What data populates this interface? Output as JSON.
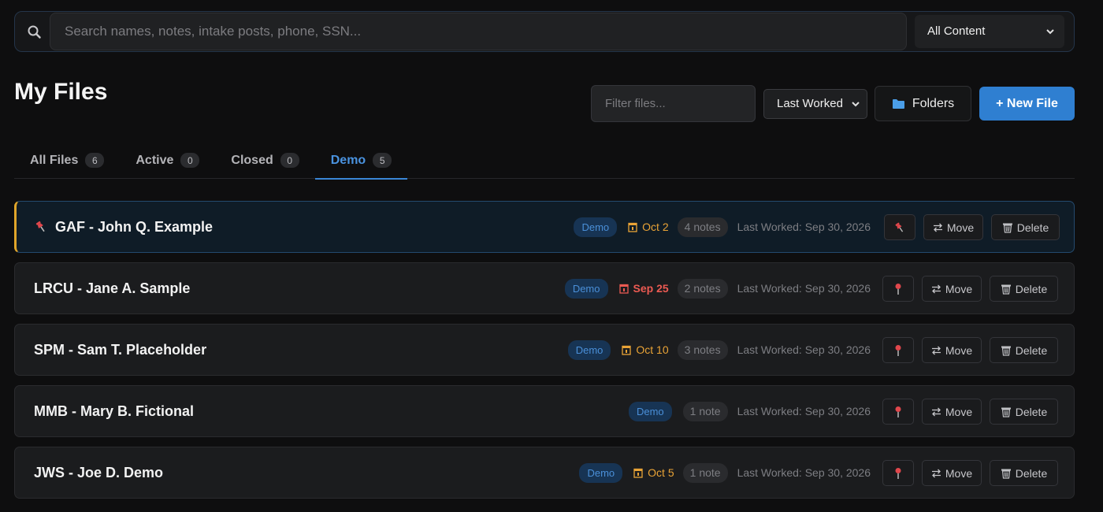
{
  "search": {
    "placeholder": "Search names, notes, intake posts, phone, SSN...",
    "icon": "search-icon",
    "scope": {
      "selected": "All Content"
    }
  },
  "header": {
    "title": "My Files",
    "filter_placeholder": "Filter files...",
    "sort": {
      "selected": "Last Worked"
    },
    "folders_label": "Folders",
    "new_file_label": "+ New File"
  },
  "tabs": [
    {
      "label": "All Files",
      "count": "6",
      "active": false
    },
    {
      "label": "Active",
      "count": "0",
      "active": false
    },
    {
      "label": "Closed",
      "count": "0",
      "active": false
    },
    {
      "label": "Demo",
      "count": "5",
      "active": true
    }
  ],
  "files": [
    {
      "name": "GAF - John Q. Example",
      "pinned": true,
      "tag": "Demo",
      "due": "Oct 2",
      "due_status": "upcoming",
      "notes": "4 notes",
      "last_worked": "Last Worked: Sep 30, 2026"
    },
    {
      "name": "LRCU - Jane A. Sample",
      "pinned": false,
      "tag": "Demo",
      "due": "Sep 25",
      "due_status": "overdue",
      "notes": "2 notes",
      "last_worked": "Last Worked: Sep 30, 2026"
    },
    {
      "name": "SPM - Sam T. Placeholder",
      "pinned": false,
      "tag": "Demo",
      "due": "Oct 10",
      "due_status": "upcoming",
      "notes": "3 notes",
      "last_worked": "Last Worked: Sep 30, 2026"
    },
    {
      "name": "MMB - Mary B. Fictional",
      "pinned": false,
      "tag": "Demo",
      "due": "",
      "due_status": "none",
      "notes": "1 note",
      "last_worked": "Last Worked: Sep 30, 2026"
    },
    {
      "name": "JWS - Joe D. Demo",
      "pinned": false,
      "tag": "Demo",
      "due": "Oct 5",
      "due_status": "upcoming",
      "notes": "1 note",
      "last_worked": "Last Worked: Sep 30, 2026"
    }
  ],
  "row_actions": {
    "move_label": "Move",
    "delete_label": "Delete"
  },
  "colors": {
    "accent": "#2f7fd1",
    "tab_active": "#4a93e0",
    "due_upcoming": "#e9a336",
    "due_overdue": "#ec5a52",
    "pinned_border": "#e0a52a",
    "demo_badge_bg": "#173454"
  }
}
